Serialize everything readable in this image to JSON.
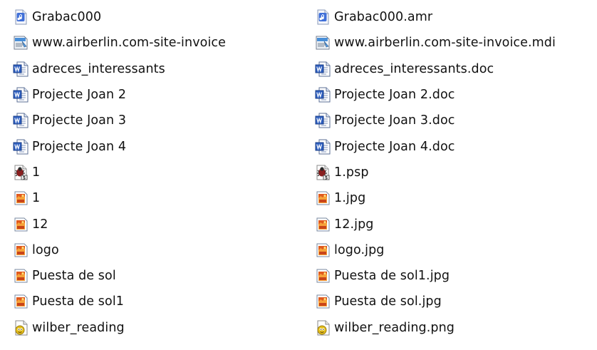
{
  "left_panel": {
    "items": [
      {
        "name": "Grabac000",
        "icon": "amr-audio-file-icon"
      },
      {
        "name": "www.airberlin.com-site-invoice",
        "icon": "mdi-document-file-icon"
      },
      {
        "name": "adreces_interessants",
        "icon": "word-document-icon"
      },
      {
        "name": "Projecte Joan 2",
        "icon": "word-document-icon"
      },
      {
        "name": "Projecte Joan 3",
        "icon": "word-document-icon"
      },
      {
        "name": "Projecte Joan 4",
        "icon": "word-document-icon"
      },
      {
        "name": "1",
        "icon": "psp-bug-file-icon"
      },
      {
        "name": "1",
        "icon": "jpg-image-file-icon"
      },
      {
        "name": "12",
        "icon": "jpg-image-file-icon"
      },
      {
        "name": "logo",
        "icon": "jpg-image-file-icon"
      },
      {
        "name": "Puesta de sol",
        "icon": "jpg-image-file-icon"
      },
      {
        "name": "Puesta de sol1",
        "icon": "jpg-image-file-icon"
      },
      {
        "name": "wilber_reading",
        "icon": "png-image-file-icon"
      }
    ]
  },
  "right_panel": {
    "items": [
      {
        "name": "Grabac000.amr",
        "icon": "amr-audio-file-icon"
      },
      {
        "name": "www.airberlin.com-site-invoice.mdi",
        "icon": "mdi-document-file-icon"
      },
      {
        "name": "adreces_interessants.doc",
        "icon": "word-document-icon"
      },
      {
        "name": "Projecte Joan 2.doc",
        "icon": "word-document-icon"
      },
      {
        "name": "Projecte Joan 3.doc",
        "icon": "word-document-icon"
      },
      {
        "name": "Projecte Joan 4.doc",
        "icon": "word-document-icon"
      },
      {
        "name": "1.psp",
        "icon": "psp-bug-file-icon"
      },
      {
        "name": "1.jpg",
        "icon": "jpg-image-file-icon"
      },
      {
        "name": "12.jpg",
        "icon": "jpg-image-file-icon"
      },
      {
        "name": "logo.jpg",
        "icon": "jpg-image-file-icon"
      },
      {
        "name": "Puesta de sol1.jpg",
        "icon": "jpg-image-file-icon"
      },
      {
        "name": "Puesta de sol.jpg",
        "icon": "jpg-image-file-icon"
      },
      {
        "name": "wilber_reading.png",
        "icon": "png-image-file-icon"
      }
    ]
  }
}
